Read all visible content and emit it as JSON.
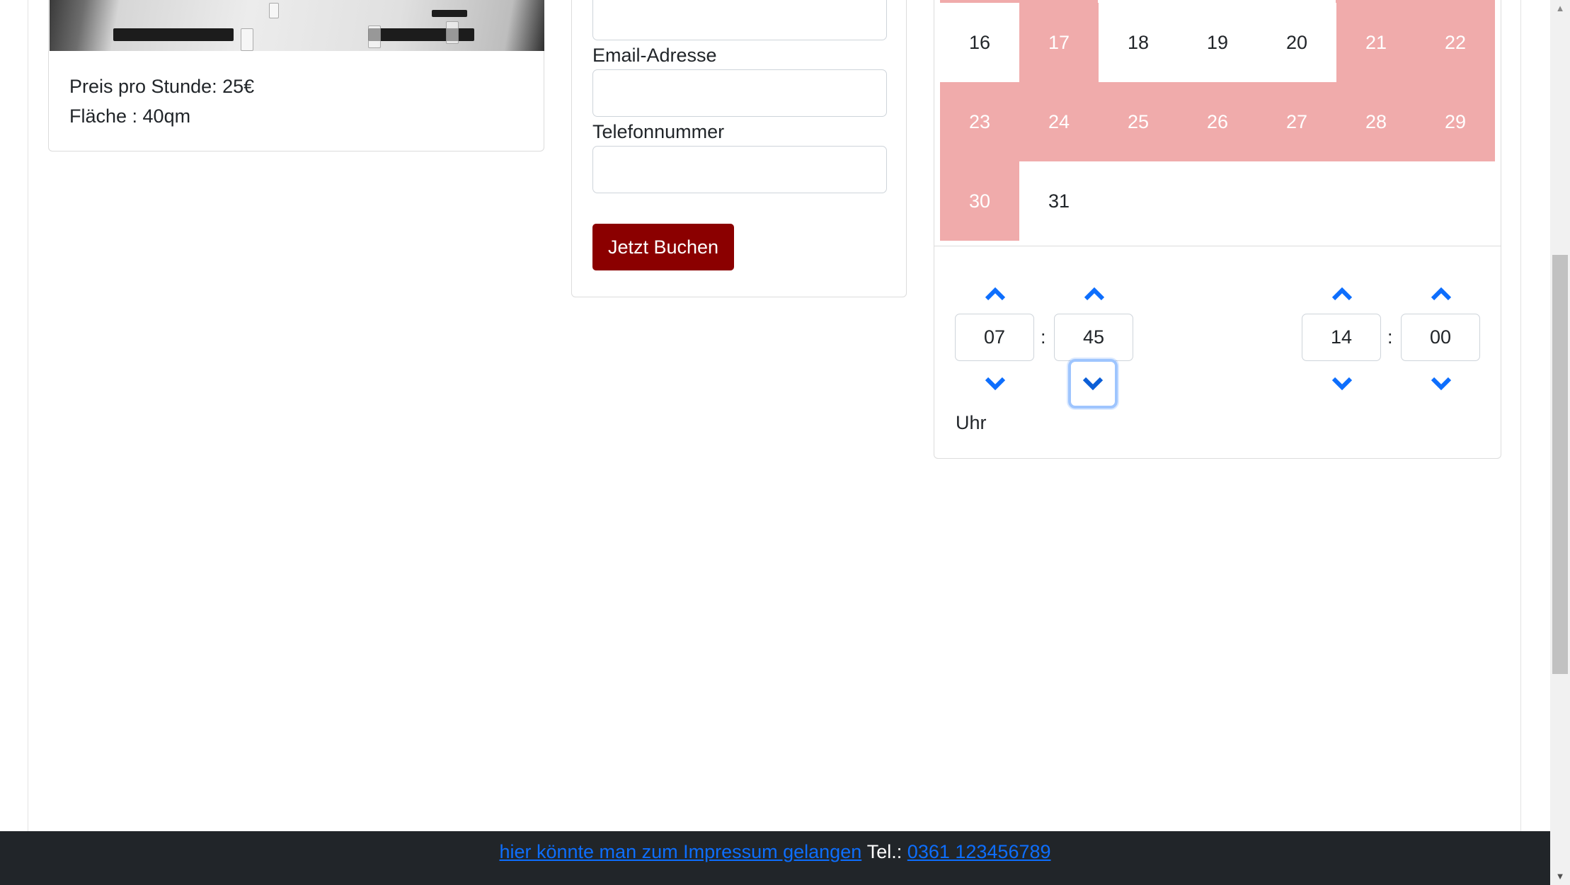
{
  "room": {
    "price_text": "Preis pro Stunde: 25€",
    "area_text": "Fläche : 40qm"
  },
  "form": {
    "email_label": "Email-Adresse",
    "phone_label": "Telefonnummer",
    "email_value": "",
    "phone_value": "",
    "submit_label": "Jetzt Buchen"
  },
  "calendar": {
    "rows": [
      [
        {
          "day": "16",
          "booked": false
        },
        {
          "day": "17",
          "booked": true
        },
        {
          "day": "18",
          "booked": false
        },
        {
          "day": "19",
          "booked": false
        },
        {
          "day": "20",
          "booked": false
        },
        {
          "day": "21",
          "booked": true
        },
        {
          "day": "22",
          "booked": true
        }
      ],
      [
        {
          "day": "23",
          "booked": true
        },
        {
          "day": "24",
          "booked": true
        },
        {
          "day": "25",
          "booked": true
        },
        {
          "day": "26",
          "booked": true
        },
        {
          "day": "27",
          "booked": true
        },
        {
          "day": "28",
          "booked": true
        },
        {
          "day": "29",
          "booked": true
        }
      ],
      [
        {
          "day": "30",
          "booked": true
        },
        {
          "day": "31",
          "booked": false
        }
      ]
    ],
    "booked_color": "#f0abab"
  },
  "time_picker": {
    "start_hour": "07",
    "start_minute": "45",
    "end_hour": "14",
    "end_minute": "00",
    "separator": ":",
    "unit_label": "Uhr",
    "chevron_color": "#0d6efd"
  },
  "footer": {
    "imprint_link": "hier könnte man zum Impressum gelangen",
    "tel_label": "Tel.:",
    "tel_link": "0361 123456789"
  },
  "colors": {
    "button_bg": "#8b0000",
    "footer_bg": "#212529",
    "link": "#0d6efd"
  }
}
